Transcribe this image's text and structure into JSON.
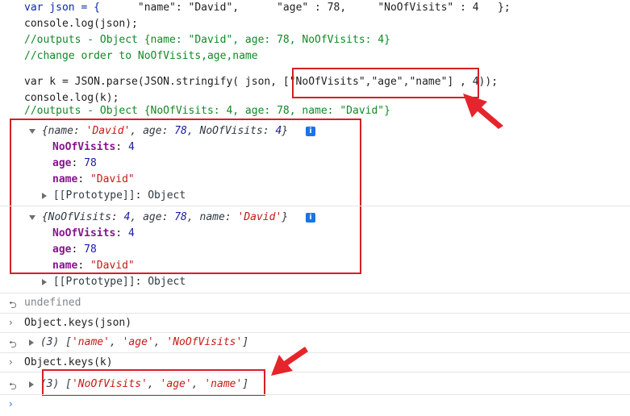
{
  "code": {
    "l1_a": "var json = {",
    "l1_b": "\"name\": \"David\",",
    "l1_c": "\"age\" : 78,",
    "l1_d": "\"NoOfVisits\" : 4",
    "l1_e": "};",
    "l2": "console.log(json);",
    "l3": "//outputs - Object {name: \"David\", age: 78, NoOfVisits: 4}",
    "l4": "//change order to NoOfVisits,age,name",
    "l5_a": "var k = JSON.parse(JSON.stringify( json, ",
    "l5_b": "[\"NoOfVisits\",\"age\",\"name\"]",
    "l5_c": " , 4));",
    "l6": "console.log(k);",
    "l7": "//outputs - Object {NoOfVisits: 4, age: 78, name: \"David\"}"
  },
  "obj1": {
    "open": "{",
    "k1": "name",
    "v1": "'David'",
    "k2": "age",
    "v2": "78",
    "k3": "NoOfVisits",
    "v3": "4",
    "close": "}",
    "info": "i",
    "props": [
      {
        "key": "NoOfVisits",
        "value": "4"
      },
      {
        "key": "age",
        "value": "78"
      },
      {
        "key": "name",
        "value": "\"David\""
      }
    ],
    "proto_key": "[[Prototype]]",
    "proto_val": "Object"
  },
  "obj2": {
    "open": "{",
    "k1": "NoOfVisits",
    "v1": "4",
    "k2": "age",
    "v2": "78",
    "k3": "name",
    "v3": "'David'",
    "close": "}",
    "info": "i",
    "props": [
      {
        "key": "NoOfVisits",
        "value": "4"
      },
      {
        "key": "age",
        "value": "78"
      },
      {
        "key": "name",
        "value": "\"David\""
      }
    ],
    "proto_key": "[[Prototype]]",
    "proto_val": "Object"
  },
  "undefined_text": "undefined",
  "cmd1": "Object.keys(json)",
  "res1": {
    "count": "(3)",
    "items": [
      "'name'",
      "'age'",
      "'NoOfVisits'"
    ]
  },
  "cmd2": "Object.keys(k)",
  "res2": {
    "count": "(3)",
    "items": [
      "'NoOfVisits'",
      "'age'",
      "'name'"
    ]
  },
  "colors": {
    "highlight": "#d32026"
  }
}
